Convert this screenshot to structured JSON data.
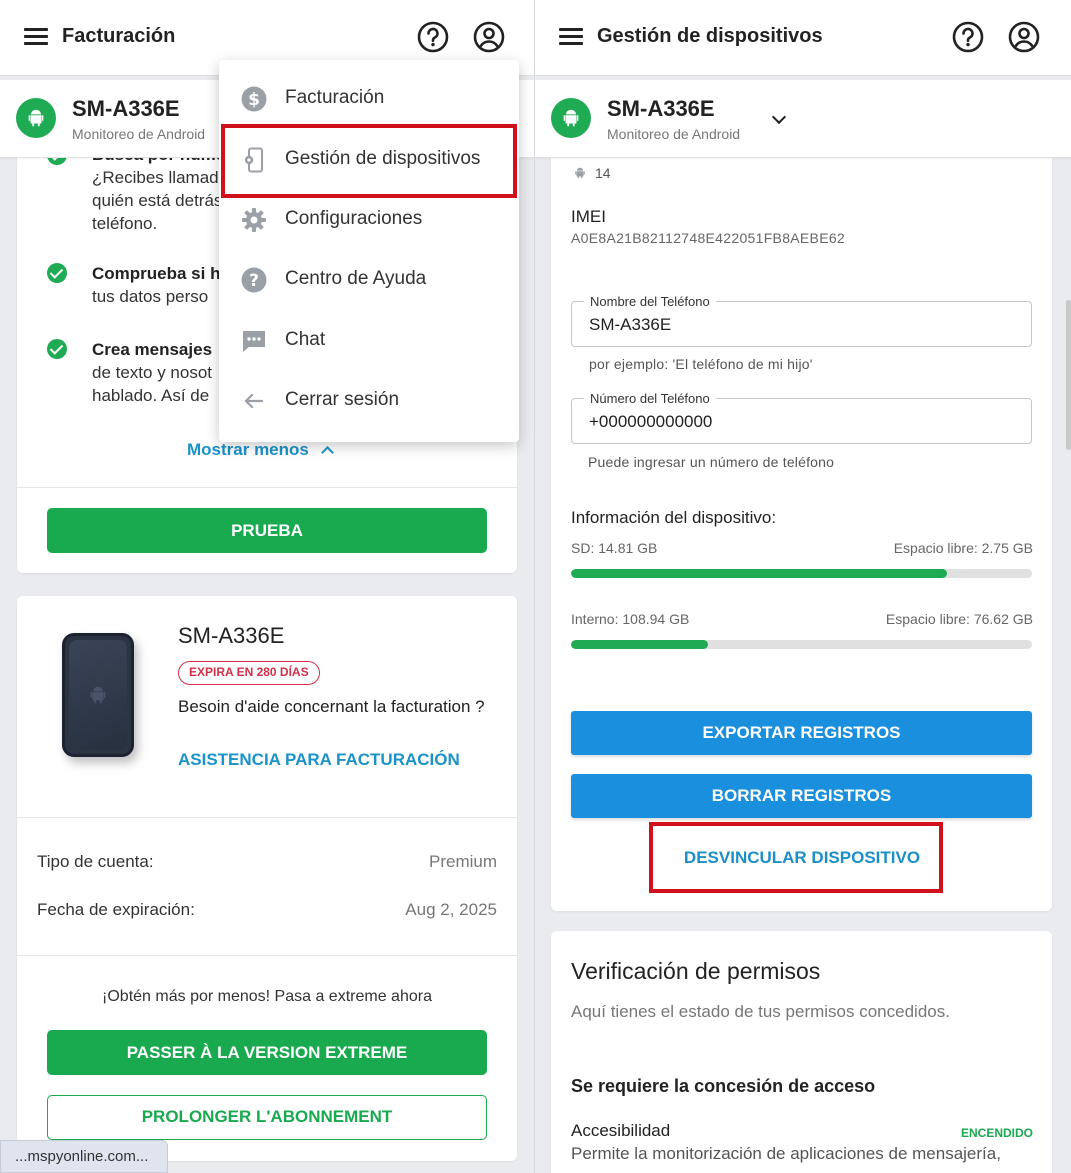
{
  "left": {
    "topbar": {
      "title": "Facturación"
    },
    "device": {
      "name": "SM-A336E",
      "subtitle": "Monitoreo de Android"
    },
    "features": {
      "item1": {
        "title": "Busca por número",
        "line1": "¿Recibes llamadas",
        "line2": "quién está detrás",
        "line3": "teléfono."
      },
      "item2": {
        "title": "Comprueba si h",
        "line1": "tus datos perso"
      },
      "item3": {
        "title": "Crea mensajes",
        "line1": "de texto y nosot",
        "line2": "hablado. Así de"
      },
      "show_less": "Mostrar menos"
    },
    "trial_button": "PRUEBA",
    "plan": {
      "device_name": "SM-A336E",
      "expire_badge": "EXPIRA EN 280 DÍAS",
      "help_text": "Besoin d'aide concernant la facturation ?",
      "help_link": "ASISTENCIA PARA FACTURACIÓN",
      "account_type_label": "Tipo de cuenta:",
      "account_type_value": "Premium",
      "expiration_label": "Fecha de expiración:",
      "expiration_value": "Aug 2, 2025",
      "upsell_text": "¡Obtén más por menos! Pasa a extreme ahora",
      "upgrade_button": "PASSER À LA VERSION EXTREME",
      "extend_button": "PROLONGER L'ABONNEMENT"
    },
    "url_chip": "...mspyonline.com..."
  },
  "menu": {
    "items": [
      {
        "label": "Facturación",
        "icon": "dollar-circle-icon"
      },
      {
        "label": "Gestión de dispositivos",
        "icon": "phone-gear-icon",
        "highlighted": true
      },
      {
        "label": "Configuraciones",
        "icon": "gear-icon"
      },
      {
        "label": "Centro de Ayuda",
        "icon": "help-circle-icon"
      },
      {
        "label": "Chat",
        "icon": "chat-bubble-icon"
      },
      {
        "label": "Cerrar sesión",
        "icon": "arrow-left-icon"
      }
    ]
  },
  "right": {
    "topbar": {
      "title": "Gestión de dispositivos"
    },
    "device": {
      "name": "SM-A336E",
      "subtitle": "Monitoreo de Android"
    },
    "android_version": "14",
    "imei_label": "IMEI",
    "imei_value": "A0E8A21B82112748E422051FB8AEBE62",
    "phone_name": {
      "legend": "Nombre del Teléfono",
      "value": "SM-A336E",
      "help": "por ejemplo: 'El teléfono de mi hijo'"
    },
    "phone_number": {
      "legend": "Número del Teléfono",
      "value": "+000000000000",
      "help": "Puede ingresar un número de teléfono"
    },
    "device_info": {
      "label": "Información del dispositivo:",
      "sd": {
        "label": "SD: 14.81 GB",
        "free": "Espacio libre: 2.75 GB",
        "used_fraction": 0.815
      },
      "internal": {
        "label": "Interno: 108.94 GB",
        "free": "Espacio libre: 76.62 GB",
        "used_fraction": 0.297
      }
    },
    "export_button": "EXPORTAR REGISTROS",
    "delete_button": "BORRAR REGISTROS",
    "unlink_button": "DESVINCULAR DISPOSITIVO",
    "permissions": {
      "title": "Verificación de permisos",
      "subtitle": "Aquí tienes el estado de tus permisos concedidos.",
      "required_label": "Se requiere la concesión de acceso",
      "item_name": "Accesibilidad",
      "item_status": "ENCENDIDO",
      "item_desc": "Permite la monitorización de aplicaciones de mensajería,"
    }
  },
  "colors": {
    "green": "#19a94f",
    "blue": "#1a8fdd",
    "link": "#1b93c9",
    "highlight_red": "#d0101a",
    "badge_red": "#d4304a"
  }
}
